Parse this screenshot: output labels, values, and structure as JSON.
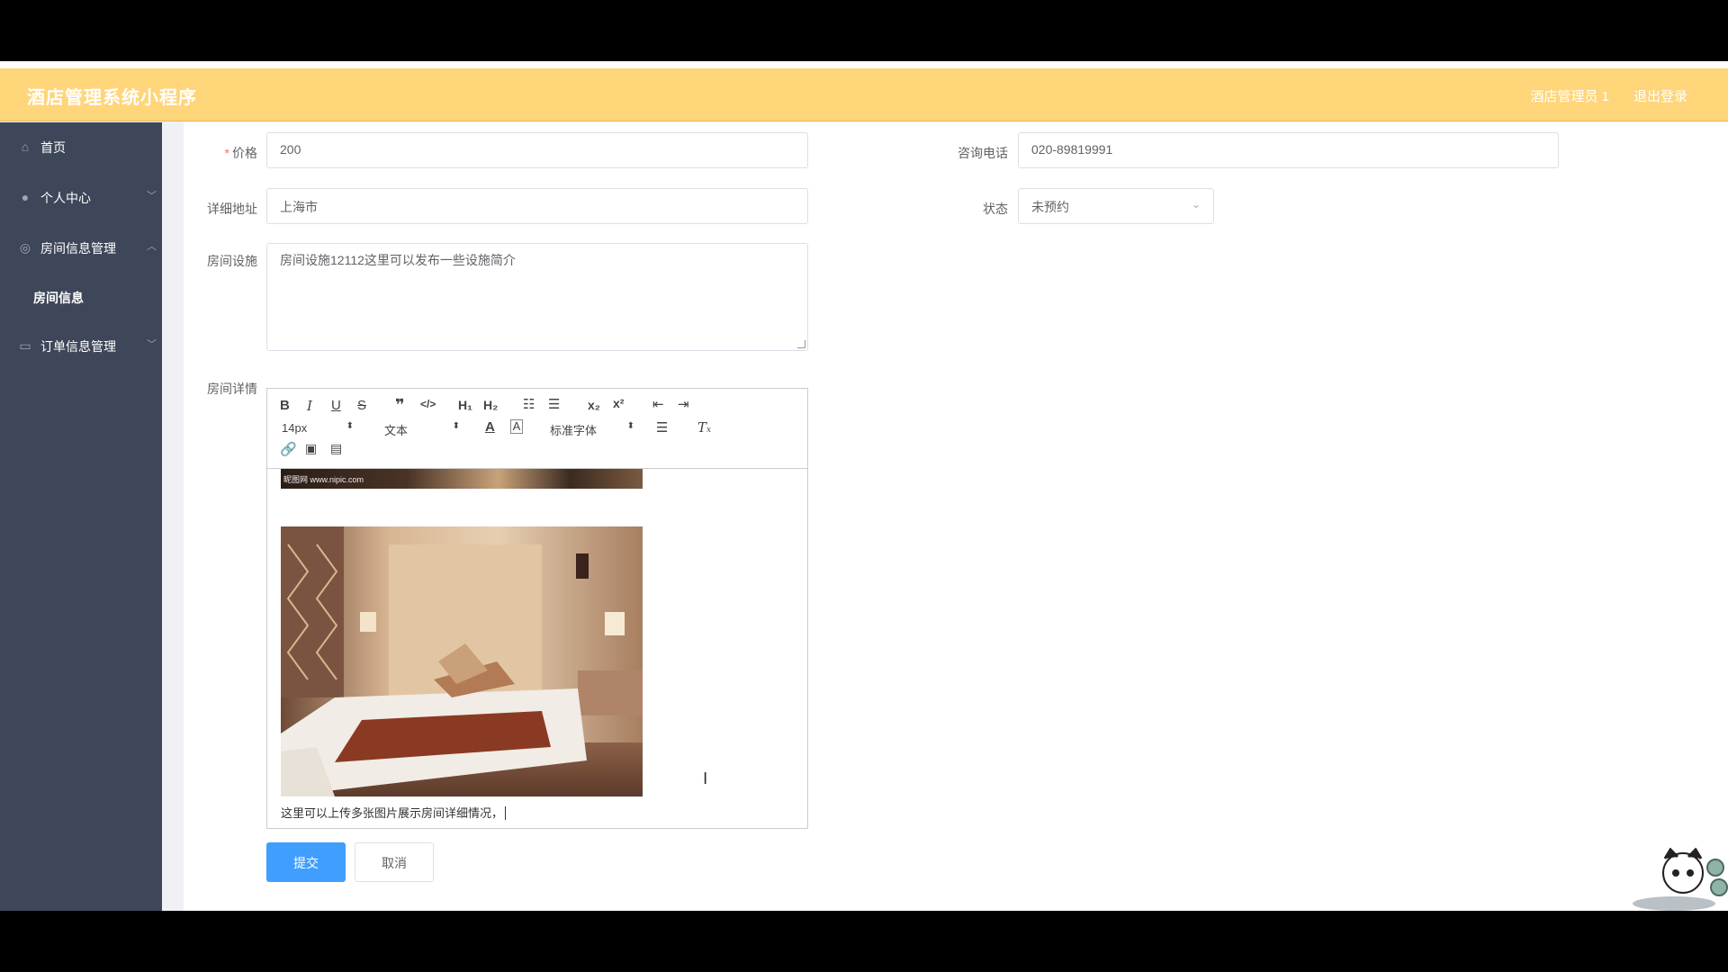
{
  "header": {
    "title": "酒店管理系统小程序",
    "user": "酒店管理员 1",
    "logout": "退出登录"
  },
  "sidebar": {
    "items": [
      {
        "label": "首页"
      },
      {
        "label": "个人中心"
      },
      {
        "label": "房间信息管理"
      },
      {
        "label": "房间信息"
      },
      {
        "label": "订单信息管理"
      }
    ]
  },
  "form": {
    "price": {
      "label": "价格",
      "value": "200"
    },
    "phone": {
      "label": "咨询电话",
      "value": "020-89819991"
    },
    "address": {
      "label": "详细地址",
      "value": "上海市"
    },
    "status": {
      "label": "状态",
      "value": "未预约"
    },
    "facilities": {
      "label": "房间设施",
      "value": "房间设施12112这里可以发布一些设施简介"
    },
    "details": {
      "label": "房间详情"
    }
  },
  "editor": {
    "font_size": "14px",
    "text_type": "文本",
    "font_family": "标准字体",
    "watermark": "昵图网 www.nipic.com",
    "body_text": "这里可以上传多张图片展示房间详细情况，"
  },
  "buttons": {
    "submit": "提交",
    "cancel": "取消"
  },
  "colors": {
    "header": "#ffd57a",
    "sidebar": "#3e4759",
    "primary": "#409eff"
  },
  "icons": [
    "home-icon",
    "user-icon",
    "room-icon",
    "order-icon",
    "chevron-icon",
    "select-arrow-icon",
    "bold-icon",
    "italic-icon",
    "underline-icon",
    "strike-icon",
    "quote-icon",
    "code-icon",
    "h1-icon",
    "h2-icon",
    "ordered-list-icon",
    "bullet-list-icon",
    "subscript-icon",
    "superscript-icon",
    "outdent-icon",
    "indent-icon",
    "font-color-icon",
    "background-color-icon",
    "align-icon",
    "clear-format-icon",
    "link-icon",
    "image-icon",
    "video-icon"
  ]
}
